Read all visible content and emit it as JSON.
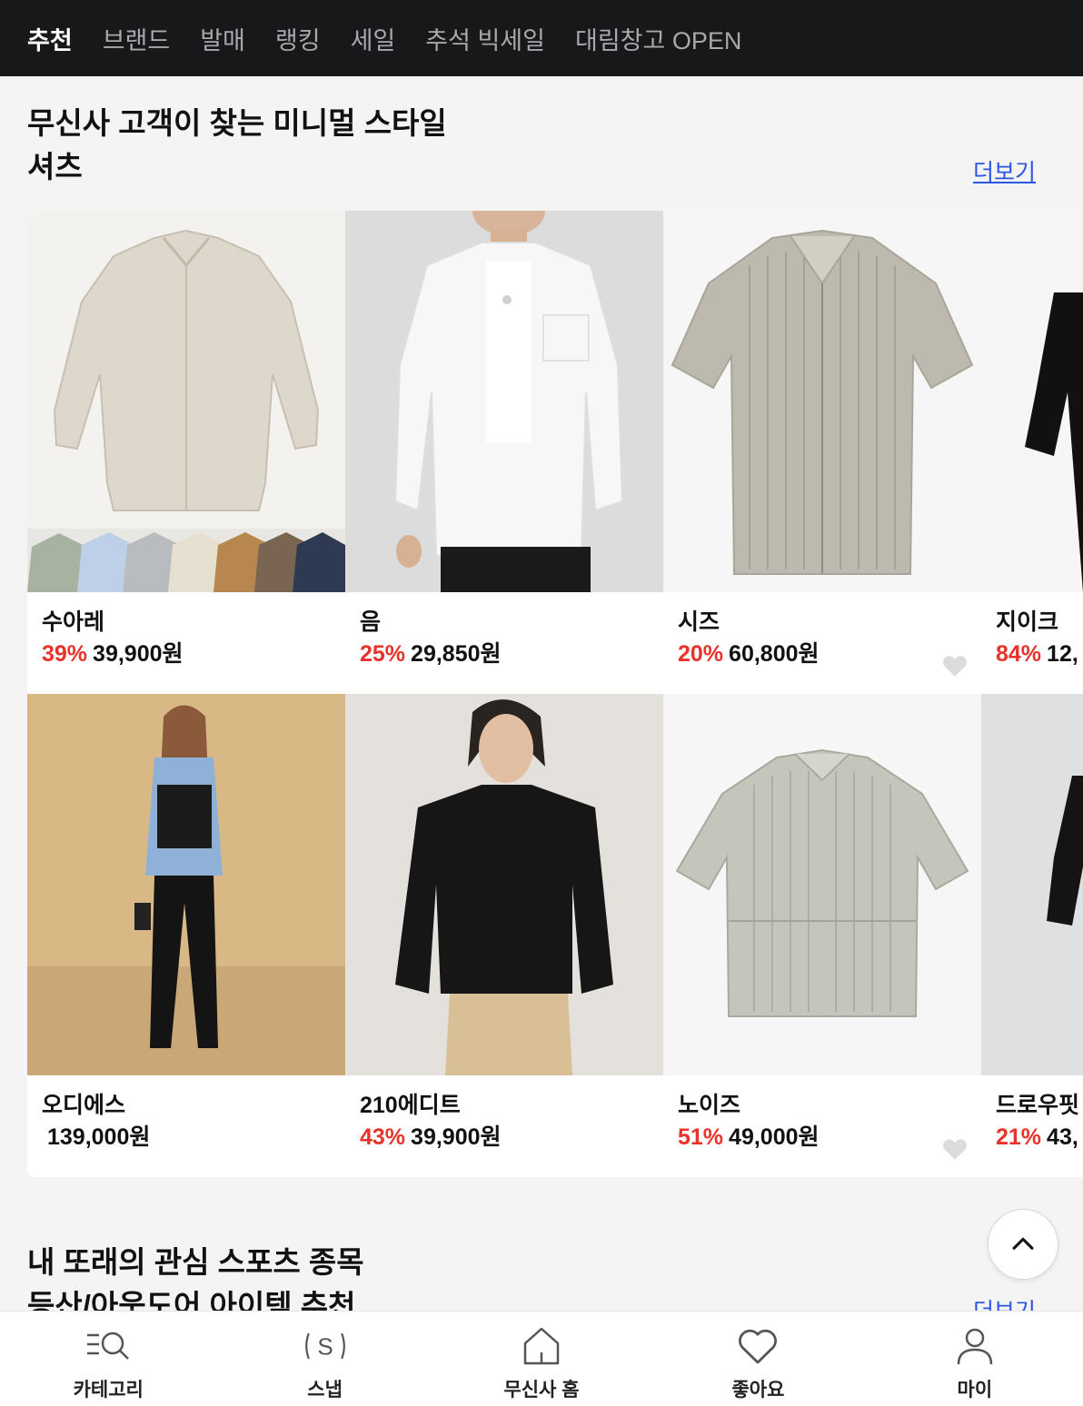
{
  "top_nav": {
    "tabs": [
      {
        "label": "추천",
        "active": true
      },
      {
        "label": "브랜드",
        "active": false
      },
      {
        "label": "발매",
        "active": false
      },
      {
        "label": "랭킹",
        "active": false
      },
      {
        "label": "세일",
        "active": false
      },
      {
        "label": "추석 빅세일",
        "active": false
      },
      {
        "label": "대림창고 OPEN",
        "active": false
      }
    ]
  },
  "section1": {
    "title_line1": "무신사 고객이 찾는 미니멀 스타일",
    "title_line2": "셔츠",
    "more_label": "더보기",
    "products": [
      {
        "brand": "수아레",
        "discount": "39%",
        "price": "39,900원",
        "image": "beige-linen-shirt-with-color-swatches"
      },
      {
        "brand": "음",
        "discount": "25%",
        "price": "29,850원",
        "image": "model-white-shirt"
      },
      {
        "brand": "시즈",
        "discount": "20%",
        "price": "60,800원",
        "image": "grey-striped-short-sleeve-shirt"
      },
      {
        "brand": "지이크",
        "discount": "84%",
        "price": "12,",
        "image": "black-shirt-cropped"
      },
      {
        "brand": "오디에스",
        "discount": "",
        "price": "139,000원",
        "image": "model-blue-shirt-black-vest"
      },
      {
        "brand": "210에디트",
        "discount": "43%",
        "price": "39,900원",
        "image": "model-black-shirt-beige-pants"
      },
      {
        "brand": "노이즈",
        "discount": "51%",
        "price": "49,000원",
        "image": "grey-striped-short-sleeve-shirt-2"
      },
      {
        "brand": "드로우핏",
        "discount": "21%",
        "price": "43,",
        "image": "model-black-tshirt-cropped"
      }
    ]
  },
  "section2": {
    "title_line1": "내 또래의 관심 스포츠 종목",
    "title_line2": "등산/아웃도어 아이템 추천",
    "more_label": "더보기"
  },
  "scroll_top": {
    "icon": "chevron-up-icon"
  },
  "bottom_nav": {
    "items": [
      {
        "label": "카테고리",
        "icon": "category-search-icon"
      },
      {
        "label": "스냅",
        "icon": "snap-s-icon"
      },
      {
        "label": "무신사 홈",
        "icon": "home-icon"
      },
      {
        "label": "좋아요",
        "icon": "heart-icon"
      },
      {
        "label": "마이",
        "icon": "person-icon"
      }
    ]
  },
  "colors": {
    "nav_bg": "#17181a",
    "discount_red": "#e8332a",
    "link_blue": "#2a55e5"
  }
}
